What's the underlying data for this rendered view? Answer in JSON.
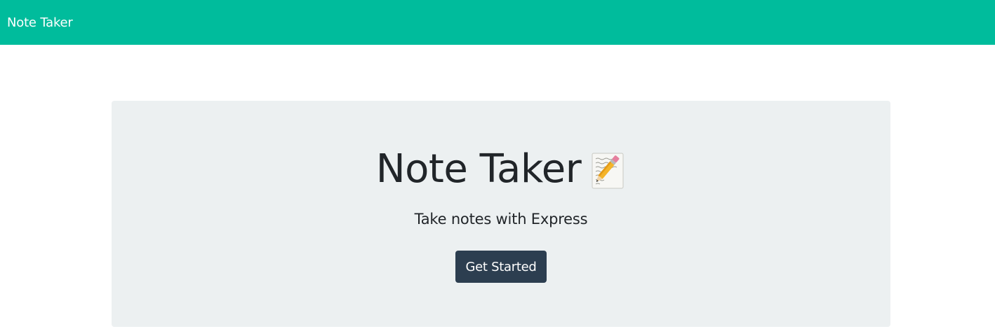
{
  "navbar": {
    "brand": "Note Taker",
    "background_color": "#00bc9c"
  },
  "hero": {
    "title": "Note Taker",
    "title_icon": "memo-icon",
    "subtitle": "Take notes with Express",
    "button_label": "Get Started",
    "button_color": "#2c3e50",
    "panel_color": "#ecf0f1"
  }
}
